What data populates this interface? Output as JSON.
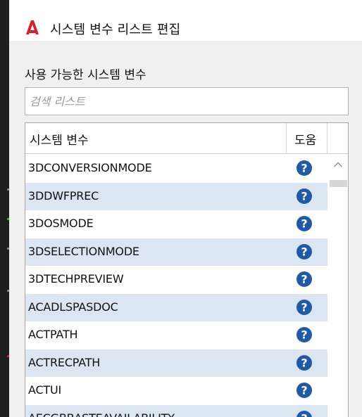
{
  "dialog": {
    "title": "시스템 변수 리스트 편집",
    "section_label": "사용 가능한 시스템 변수",
    "search": {
      "placeholder": "검색 리스트",
      "value": ""
    }
  },
  "list": {
    "columns": {
      "name": "시스템 변수",
      "help": "도움"
    },
    "rows": [
      {
        "name": "3DCONVERSIONMODE"
      },
      {
        "name": "3DDWFPREC"
      },
      {
        "name": "3DOSMODE"
      },
      {
        "name": "3DSELECTIONMODE"
      },
      {
        "name": "3DTECHPREVIEW"
      },
      {
        "name": "ACADLSPASDOC"
      },
      {
        "name": "ACTPATH"
      },
      {
        "name": "ACTRECPATH"
      },
      {
        "name": "ACTUI"
      },
      {
        "name": "AECGBBASTEAVAILABILITY"
      }
    ]
  },
  "colors": {
    "accent": "#d8202a",
    "help_icon": "#1e5aa8",
    "row_alt": "#dce6f2"
  },
  "icons": {
    "app": "autocad-logo-icon",
    "help": "help-question-icon",
    "scroll_up": "chevron-up-icon"
  }
}
